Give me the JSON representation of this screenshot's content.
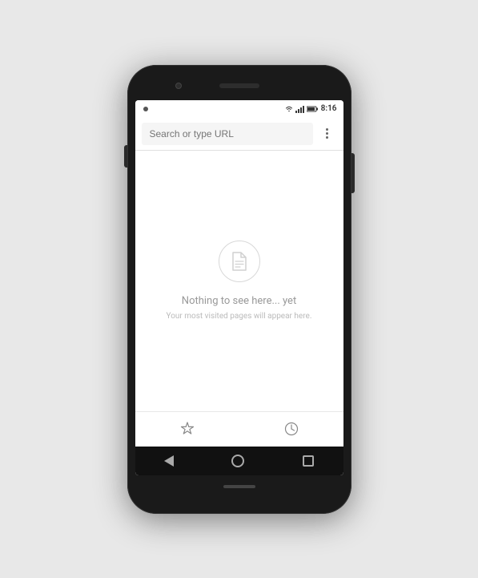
{
  "phone": {
    "status_bar": {
      "time": "8:16",
      "notification_icon": "●"
    },
    "address_bar": {
      "placeholder": "Search or type URL",
      "menu_label": "⋮"
    },
    "empty_state": {
      "title": "Nothing to see here... yet",
      "subtitle": "Your most visited pages will appear here."
    },
    "tab_bar": {
      "bookmarks_icon": "bookmarks-icon",
      "history_icon": "history-icon"
    },
    "nav_bar": {
      "back_icon": "back-icon",
      "home_icon": "home-icon",
      "recents_icon": "recents-icon"
    }
  }
}
